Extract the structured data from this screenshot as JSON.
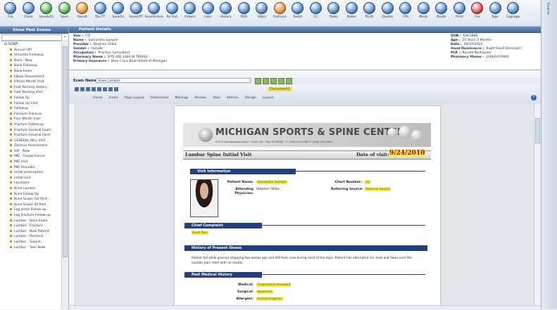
{
  "toolbar": {
    "buttons": [
      {
        "label": "File",
        "color": "blue"
      },
      {
        "label": "Close",
        "color": "blue"
      },
      {
        "label": "Save&Clt",
        "color": "green"
      },
      {
        "label": "Save",
        "color": "green"
      },
      {
        "label": "Result",
        "color": "orange"
      },
      {
        "label": "DocTT",
        "color": "blue"
      },
      {
        "label": "Save2x",
        "color": "blue"
      },
      {
        "label": "SaveCPT",
        "color": "blue"
      },
      {
        "label": "SaveOrders",
        "color": "blue"
      },
      {
        "label": "Rx Pad",
        "color": "blue"
      },
      {
        "label": "Orders",
        "color": "blue"
      },
      {
        "label": "Labs",
        "color": "blue"
      },
      {
        "label": "History",
        "color": "blue"
      },
      {
        "label": "ROS",
        "color": "blue"
      },
      {
        "label": "Vitals",
        "color": "blue"
      },
      {
        "label": "Protocol",
        "color": "orange"
      },
      {
        "label": "ReOH",
        "color": "blue"
      },
      {
        "label": "CC",
        "color": "blue"
      },
      {
        "label": "Tasks",
        "color": "blue"
      },
      {
        "label": "Notes",
        "color": "blue"
      },
      {
        "label": "PErRr",
        "color": "blue"
      },
      {
        "label": "Quotes",
        "color": "blue"
      },
      {
        "label": "CPS",
        "color": "blue"
      },
      {
        "label": "Meds",
        "color": "blue"
      },
      {
        "label": "Route",
        "color": "blue"
      },
      {
        "label": "Print",
        "color": "blue"
      },
      {
        "label": "Fax",
        "color": "red"
      },
      {
        "label": "Sign",
        "color": "blue"
      },
      {
        "label": "Esgnage",
        "color": "blue"
      }
    ]
  },
  "right_bar": {
    "title": "Exams"
  },
  "sidebar": {
    "title": "Show Past Exams",
    "search_placeholder": "",
    "root": "SOAP",
    "items": [
      "Annual HPI",
      "Shoulder Followup",
      "Back - New",
      "Back Followup",
      "Back Exam",
      "Elbow Assessment",
      "Fifteen Month Visit",
      "Foot Nursing History",
      "Foot Nursing Visit",
      "Follow Up",
      "Follow Up Visit",
      "Followup",
      "Forearm Fracture",
      "Four Month Visit",
      "Fracture Follow-up",
      "Fracture General Exam",
      "Fracture General Form",
      "GENERAL Misc Visit",
      "General Assessment",
      "HIP - New",
      "IME - Carpal tunnel",
      "IME Visit",
      "IME Shoulder",
      "Initial prescription",
      "Initial visit",
      "Injections",
      "Knee Lumbar",
      "Knee Follow Up",
      "Knee Scope 1st Post",
      "Knee Scope 2d Post",
      "Leg ankle Follow-up",
      "Leg Fracture Follow-up",
      "Lumbar - Back Exam",
      "Lumbar - Fracture",
      "Lumbar - New Patient",
      "Lumbar - Recheck",
      "Lumbar - Supine",
      "Lumbar - Twin Note"
    ]
  },
  "patient": {
    "title": "Patient Details",
    "col1": [
      {
        "k": "Vals :",
        "v": "CO"
      },
      {
        "k": "Name :",
        "v": "Samantha Sample"
      },
      {
        "k": "Provider :",
        "v": "Stephen Orlka"
      },
      {
        "k": "Gender :",
        "v": "Female"
      },
      {
        "k": "Occupation :",
        "v": "Practice Consultant"
      },
      {
        "k": "Pharmacy Name :",
        "v": "RITE AID 3369 W TRAPLE"
      },
      {
        "k": "Primary Insurance :",
        "v": "Blue Cross Blue Shield of Michigan"
      }
    ],
    "col2": [
      {
        "k": "DOB :",
        "v": "6/6/1986"
      },
      {
        "k": "Age :",
        "v": "24 Years 3 Months"
      },
      {
        "k": "Date :",
        "v": "09/24/2010"
      },
      {
        "k": "Hand Dominance :",
        "v": "Right Hand Dominant"
      },
      {
        "k": "PCP :",
        "v": "Ronald Mulhauser"
      },
      {
        "k": "Pharmacy Phone :",
        "v": "(248)6474900"
      }
    ]
  },
  "exam": {
    "label": "Exam Name :",
    "value": "Knee Lumbar"
  },
  "word": {
    "doc_title": "Document1",
    "tabs": [
      "Home",
      "Insert",
      "Page Layout",
      "References",
      "Mailings",
      "Review",
      "View",
      "Add-Ins",
      "Design",
      "Layout"
    ]
  },
  "document": {
    "clinic_name": "MICHIGAN SPORTS & SPINE CENTER",
    "clinic_address": "470 N Old Woodward Blvd · Suite 100 · Troy MI 48083 · P: (248) 000-0000  F: (248) 000-0000",
    "doc_type": "Lumbar Spine Initial Visit",
    "date_of_visit_label": "Date of visit:",
    "date_of_visit": "9/24/2010",
    "sections": {
      "visit_info": "Visit Information",
      "chief_complaint": "Chief Complaint",
      "hpi": "History of Present Illness",
      "pmh": "Past Medical History"
    },
    "visit": {
      "patient_name_label": "Patient Name:",
      "patient_name": "Samantha Sample",
      "chart_number_label": "Chart Number:",
      "chart_number": "23",
      "attending_label": "Attending Physician:",
      "attending": "Stephen Orlka",
      "referring_label": "Referring Source:",
      "referring": "Referral Source"
    },
    "chief_complaint_value": "Back Pain",
    "hpi_text": "Patient fell while grocery shopping two weeks ago and still feels sore during most of the days. Patient has alternated ice, heat and takes over the counter pain relief with no results.",
    "pmh": {
      "medical_label": "Medical:",
      "medical": "Cholesterol elevated",
      "surgical_label": "Surgical:",
      "surgical": "Appendix",
      "allergies_label": "Allergies:",
      "allergies": "Acetaminophen"
    }
  }
}
